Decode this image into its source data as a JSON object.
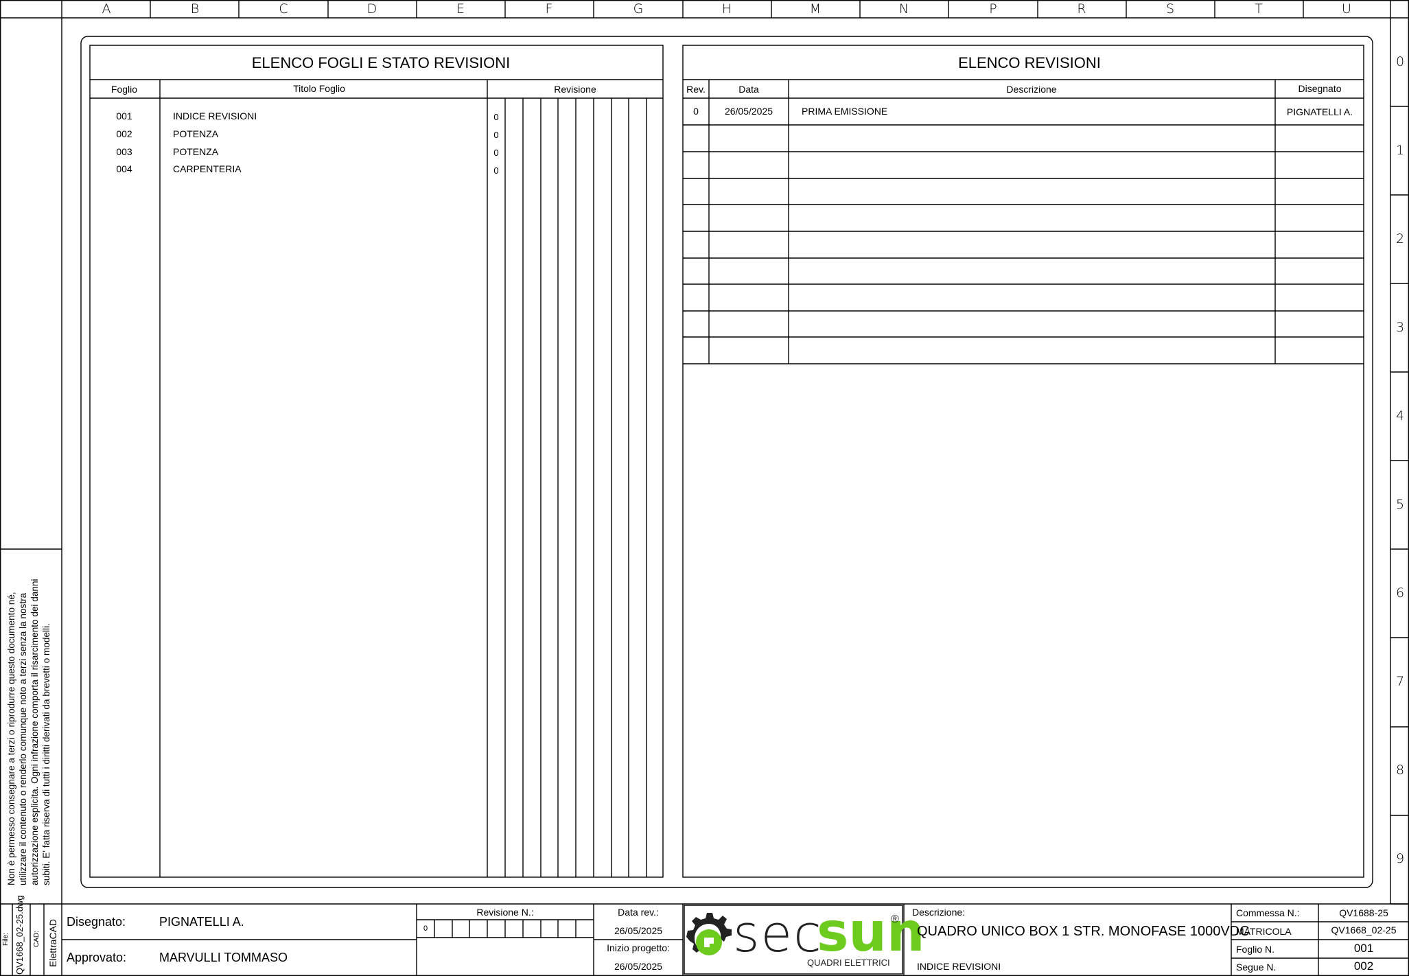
{
  "column_labels": [
    "A",
    "B",
    "C",
    "D",
    "E",
    "F",
    "G",
    "H",
    "M",
    "N",
    "P",
    "R",
    "S",
    "T",
    "U"
  ],
  "row_labels": [
    "0",
    "1",
    "2",
    "3",
    "4",
    "5",
    "6",
    "7",
    "8",
    "9"
  ],
  "sheets_section": {
    "title": "ELENCO FOGLI E STATO REVISIONI",
    "headers": {
      "sheet": "Foglio",
      "title": "Titolo Foglio",
      "revision": "Revisione"
    },
    "rows": [
      {
        "sheet": "001",
        "title": "INDICE REVISIONI",
        "revision": "0"
      },
      {
        "sheet": "002",
        "title": "POTENZA",
        "revision": "0"
      },
      {
        "sheet": "003",
        "title": "POTENZA",
        "revision": "0"
      },
      {
        "sheet": "004",
        "title": "CARPENTERIA",
        "revision": "0"
      }
    ]
  },
  "revisions_section": {
    "title": "ELENCO REVISIONI",
    "headers": {
      "rev": "Rev.",
      "date": "Data",
      "description": "Descrizione",
      "drawn": "Disegnato"
    },
    "rows": [
      {
        "rev": "0",
        "date": "26/05/2025",
        "description": "PRIMA EMISSIONE",
        "drawn": "PIGNATELLI A."
      }
    ]
  },
  "side_note": {
    "text": "Non è permesso consegnare a terzi o riprodurre questo documento né, utilizzare il contenuto o renderlo comunque noto a terzi senza la nostra autorizzazione esplicita. Ogni infrazione comporta il risarcimento dei danni subiti. E' fatta riserva di tutti i diritti derivati da brevetti o modelli.",
    "file_label": "File:",
    "file_name": "QV1668_02-25.dwg",
    "cad_label": "CAD:",
    "cad_name": "ElettraCAD"
  },
  "title_block": {
    "drawn_label": "Disegnato:",
    "drawn_value": "PIGNATELLI A.",
    "approved_label": "Approvato:",
    "approved_value": "MARVULLI TOMMASO",
    "revision_label": "Revisione N.:",
    "revision_value": "0",
    "rev_date_label": "Data rev.:",
    "rev_date_value": "26/05/2025",
    "project_start_label": "Inizio progetto:",
    "project_start_value": "26/05/2025",
    "logo_text_a": "sec",
    "logo_text_b": "sun",
    "logo_reg": "®",
    "logo_subtitle": "QUADRI ELETTRICI",
    "description_label": "Descrizione:",
    "description_value": "QUADRO UNICO BOX 1 STR. MONOFASE 1000VDC",
    "sheet_content": "INDICE REVISIONI",
    "order_label": "Commessa N.:",
    "order_value": "QV1688-25",
    "serial_label": "MATRICOLA",
    "serial_value": "QV1668_02-25",
    "sheet_no_label": "Foglio N.",
    "sheet_no_value": "001",
    "next_label": "Segue N.",
    "next_value": "002"
  },
  "colors": {
    "logo_green": "#6ccb1c",
    "logo_gray": "#222222"
  }
}
